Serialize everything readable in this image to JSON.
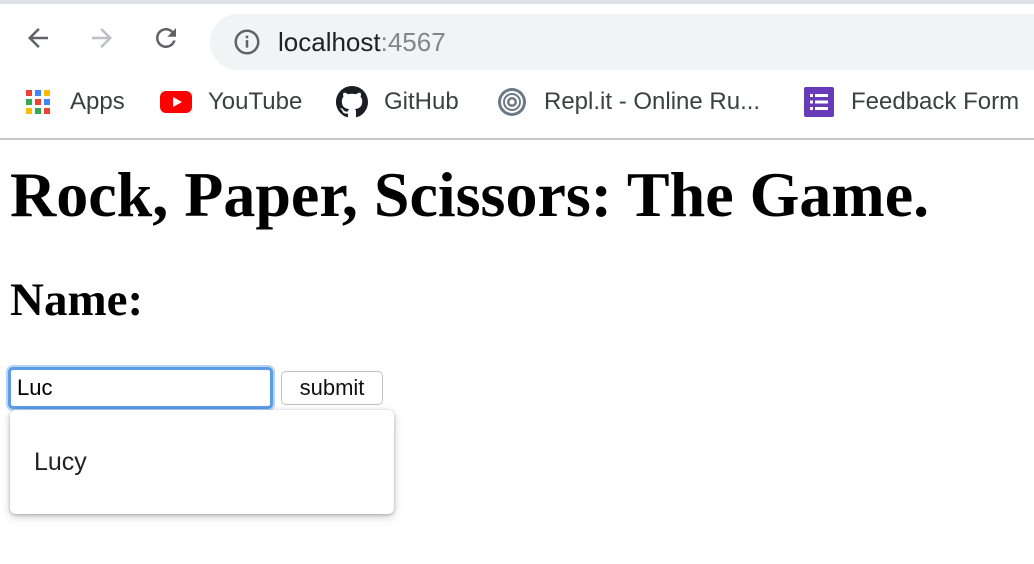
{
  "browser": {
    "nav": {
      "back_icon": "arrow-left-icon",
      "forward_icon": "arrow-right-icon",
      "reload_icon": "reload-icon"
    },
    "omnibox": {
      "icon": "info-icon",
      "host": "localhost",
      "port": ":4567"
    },
    "bookmarks": [
      {
        "label": "Apps",
        "icon": "apps-grid-icon"
      },
      {
        "label": "YouTube",
        "icon": "youtube-icon"
      },
      {
        "label": "GitHub",
        "icon": "github-icon"
      },
      {
        "label": "Repl.it - Online Ru...",
        "icon": "replit-icon"
      },
      {
        "label": "Feedback Form",
        "icon": "google-forms-icon"
      }
    ]
  },
  "page": {
    "title": "Rock, Paper, Scissors: The Game.",
    "name_label": "Name:",
    "name_input_value": "Luc",
    "submit_label": "submit",
    "autocomplete": [
      {
        "label": "Lucy"
      }
    ]
  },
  "colors": {
    "focus_ring": "#5c9ce6",
    "omnibox_bg": "#f1f3f4",
    "youtube_red": "#ff0000",
    "forms_purple": "#673ab7"
  }
}
